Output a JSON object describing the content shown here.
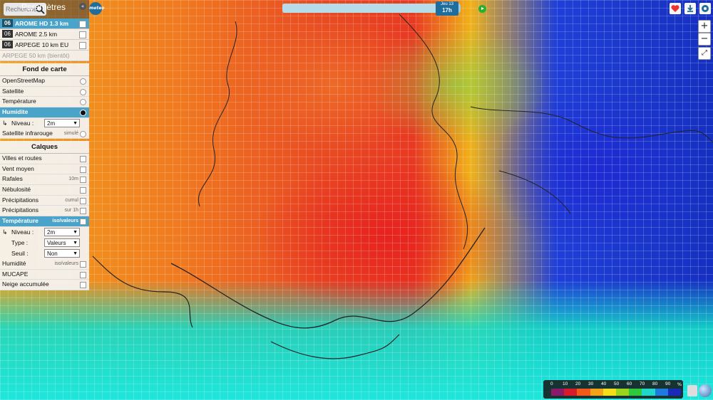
{
  "search": {
    "placeholder": "Recherche"
  },
  "panel_title": "Paramètres",
  "logo_text": "meteo",
  "models": [
    {
      "badge": "06",
      "label": "AROME HD 1.3 km",
      "selected": true
    },
    {
      "badge": "06",
      "label": "AROME 2.5 km",
      "selected": false
    },
    {
      "badge": "06",
      "label": "ARPEGE 10 km EU",
      "selected": false
    }
  ],
  "model_disabled": "ARPEGE 50 km (bientôt)",
  "basemap": {
    "title": "Fond de carte",
    "items": [
      "OpenStreetMap",
      "Satellite",
      "Température",
      "Humidite"
    ],
    "selected_index": 3,
    "level_label": "Niveau :",
    "level_value": "2m",
    "ir_label": "Satellite infrarouge",
    "ir_note": "simulé"
  },
  "layers": {
    "title": "Calques",
    "items": [
      {
        "label": "Villes et routes",
        "note": ""
      },
      {
        "label": "Vent moyen",
        "note": ""
      },
      {
        "label": "Rafales",
        "note": "10m"
      },
      {
        "label": "Nébulosité",
        "note": ""
      },
      {
        "label": "Précipitations",
        "note": "cumul"
      },
      {
        "label": "Précipitations",
        "note": "sur 1h"
      }
    ],
    "temperature": {
      "label": "Température",
      "note": "iso/valeurs"
    },
    "temp_opts": [
      {
        "label": "Niveau :",
        "value": "2m"
      },
      {
        "label": "Type :",
        "value": "Valeurs"
      },
      {
        "label": "Seuil :",
        "value": "Non"
      }
    ],
    "after": [
      {
        "label": "Humidité",
        "note": "iso/valeurs"
      },
      {
        "label": "MUCAPE",
        "note": ""
      },
      {
        "label": "Neige accumulée",
        "note": ""
      }
    ]
  },
  "time": {
    "day": "Jeu 13",
    "hour": "17h"
  },
  "legend": {
    "ticks": [
      "0",
      "10",
      "20",
      "30",
      "40",
      "50",
      "60",
      "70",
      "80",
      "90"
    ],
    "unit": "%",
    "colors": [
      "#8a1a6a",
      "#d81b2a",
      "#f25a1a",
      "#f5a21b",
      "#f3e01a",
      "#9ad41c",
      "#2fc73b",
      "#1fd6c8",
      "#1f7ae0",
      "#1a2ab8"
    ]
  },
  "zoom": {
    "in": "+",
    "out": "−"
  }
}
